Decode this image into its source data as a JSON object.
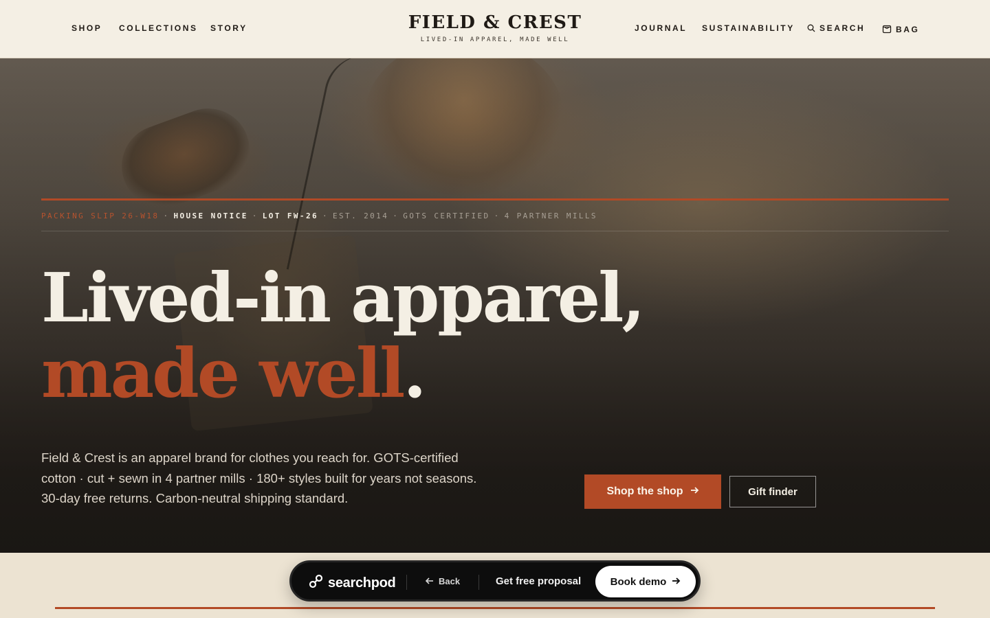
{
  "header": {
    "nav_left": [
      "SHOP",
      "COLLECTIONS",
      "STORY"
    ],
    "brand_name": "FIELD & CREST",
    "brand_tagline": "LIVED-IN APPAREL, MADE WELL",
    "nav_right": {
      "journal": "JOURNAL",
      "sustainability": "SUSTAINABILITY",
      "search": "SEARCH",
      "bag": "BAG"
    }
  },
  "hero": {
    "notice": {
      "slip": "PACKING SLIP 26-W18",
      "house_notice": "HOUSE NOTICE",
      "lot": "LOT FW-26",
      "est": "EST. 2014",
      "certified": "GOTS CERTIFIED",
      "mills": "4 PARTNER MILLS"
    },
    "headline_line1": "Lived-in apparel,",
    "headline_line2": "made well",
    "headline_dot": ".",
    "description": "Field & Crest is an apparel brand for clothes you reach for. GOTS-certified cotton · cut + sewn in 4 partner mills · 180+ styles built for years not seasons. 30-day free returns. Carbon-neutral shipping standard.",
    "primary_cta": "Shop the shop",
    "secondary_cta": "Gift finder"
  },
  "searchpod": {
    "brand": "searchpod",
    "back": "Back",
    "proposal": "Get free proposal",
    "demo": "Book demo"
  },
  "colors": {
    "accent": "#b24a26",
    "header_bg": "#f4efe4",
    "page_bg": "#ece3d2",
    "pod_bg": "#0d0d0d"
  },
  "icons": [
    "search-icon",
    "bag-icon",
    "arrow-right-icon",
    "arrow-left-icon",
    "searchpod-logo-icon"
  ]
}
